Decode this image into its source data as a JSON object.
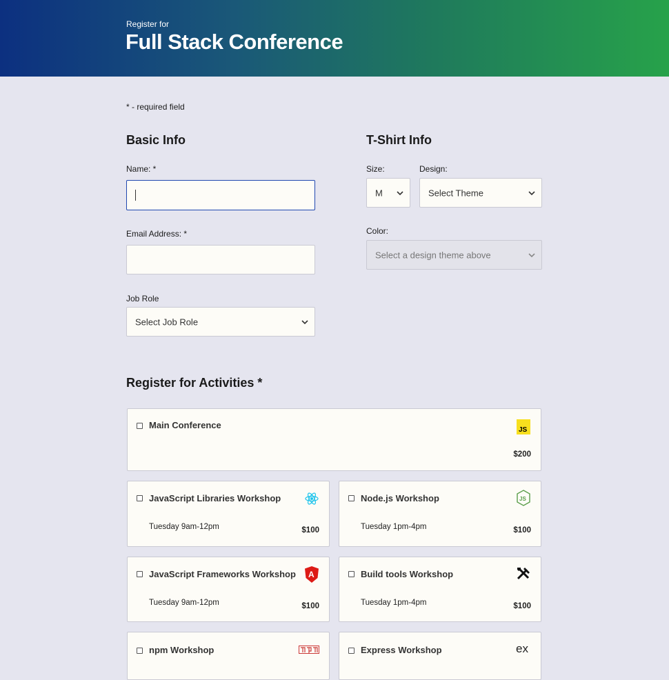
{
  "header": {
    "pre_title": "Register for",
    "title": "Full Stack Conference"
  },
  "required_note": "* - required field",
  "basic_info": {
    "heading": "Basic Info",
    "name_label": "Name: *",
    "name_value": "",
    "email_label": "Email Address: *",
    "email_value": "",
    "job_role_label": "Job Role",
    "job_role_value": "Select Job Role"
  },
  "tshirt_info": {
    "heading": "T-Shirt Info",
    "size_label": "Size:",
    "size_value": "M",
    "design_label": "Design:",
    "design_value": "Select Theme",
    "color_label": "Color:",
    "color_value": "Select a design theme above"
  },
  "activities": {
    "heading": "Register for Activities *",
    "items": [
      {
        "name": "Main Conference",
        "time": "",
        "cost": "$200",
        "icon": "js-icon",
        "checked": false
      },
      {
        "name": "JavaScript Libraries Workshop",
        "time": "Tuesday 9am-12pm",
        "cost": "$100",
        "icon": "react-icon",
        "checked": false
      },
      {
        "name": "Node.js Workshop",
        "time": "Tuesday 1pm-4pm",
        "cost": "$100",
        "icon": "nodejs-icon",
        "checked": false
      },
      {
        "name": "JavaScript Frameworks Workshop",
        "time": "Tuesday 9am-12pm",
        "cost": "$100",
        "icon": "angular-icon",
        "checked": false
      },
      {
        "name": "Build tools Workshop",
        "time": "Tuesday 1pm-4pm",
        "cost": "$100",
        "icon": "tools-icon",
        "checked": false
      },
      {
        "name": "npm Workshop",
        "time": "",
        "cost": "",
        "icon": "npm-icon",
        "checked": false
      },
      {
        "name": "Express Workshop",
        "time": "",
        "cost": "",
        "icon": "express-icon",
        "checked": false
      }
    ]
  },
  "colors": {
    "header_start": "#0c3080",
    "header_end": "#27a24a",
    "background": "#e5e5ef",
    "focus_border": "#1f47b0"
  }
}
